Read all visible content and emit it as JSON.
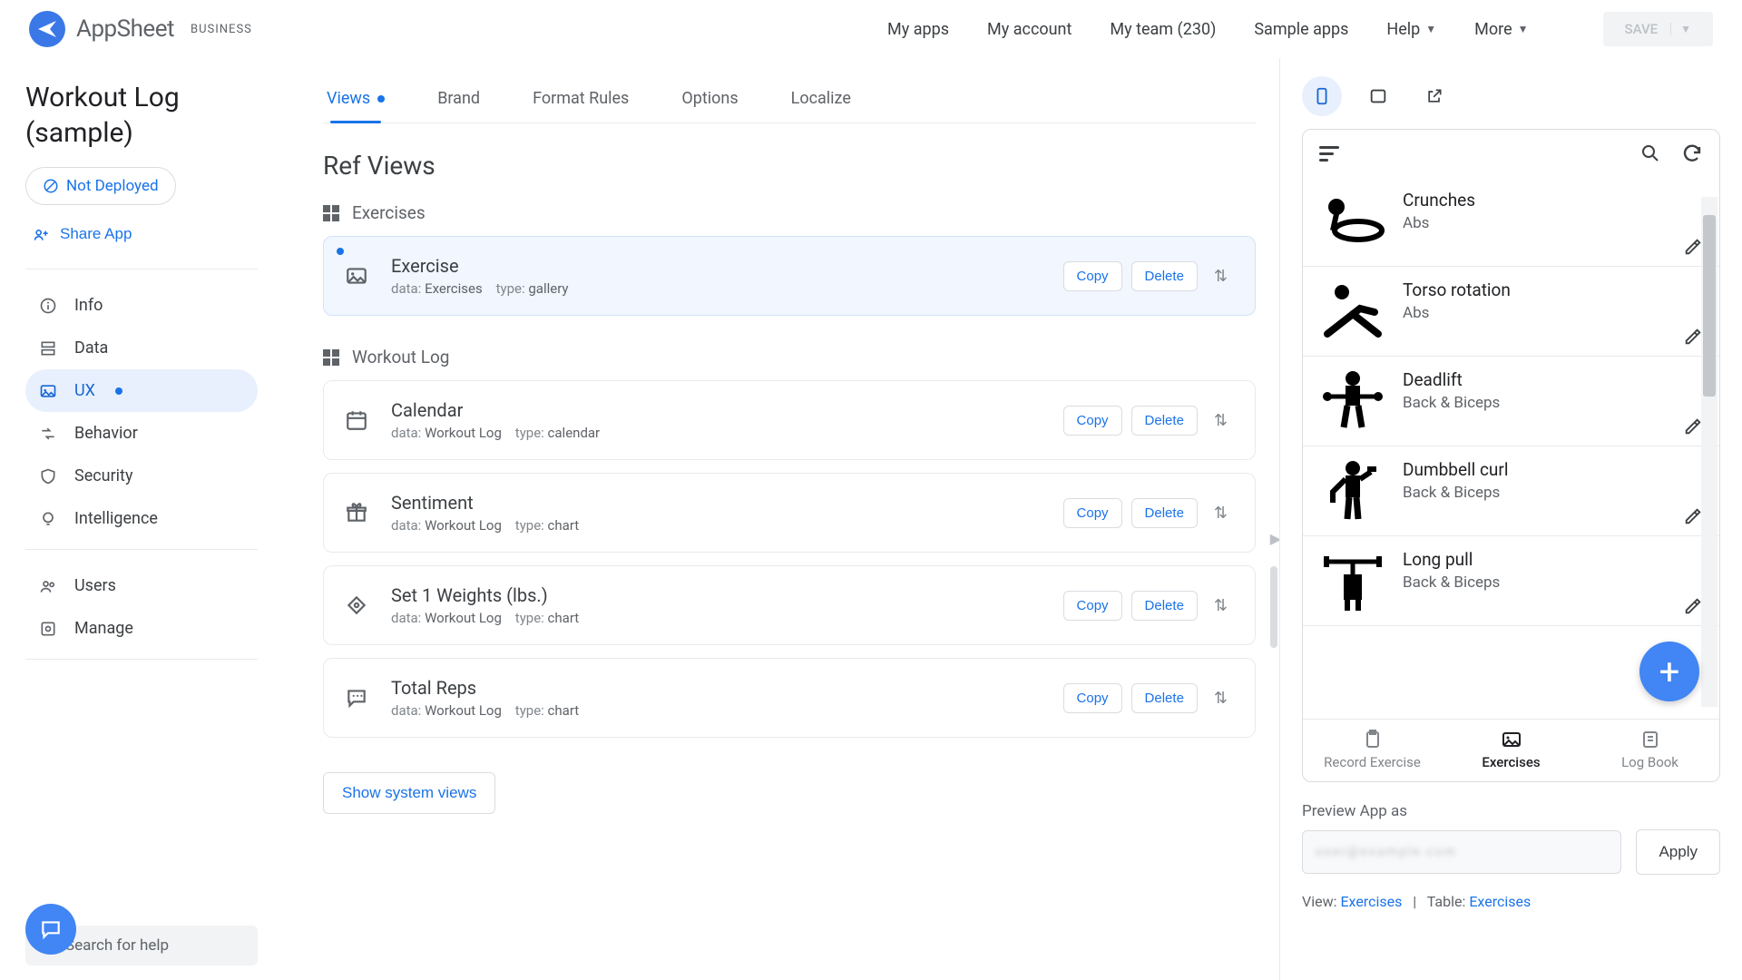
{
  "header": {
    "brand": "AppSheet",
    "tier": "BUSINESS",
    "nav": {
      "myapps": "My apps",
      "myaccount": "My account",
      "myteam": "My team (230)",
      "sample": "Sample apps",
      "help": "Help",
      "more": "More"
    },
    "save": "SAVE"
  },
  "sidebar": {
    "app_title": "Workout Log (sample)",
    "not_deployed": "Not Deployed",
    "share": "Share App",
    "items": {
      "info": "Info",
      "data": "Data",
      "ux": "UX",
      "behavior": "Behavior",
      "security": "Security",
      "intelligence": "Intelligence",
      "users": "Users",
      "manage": "Manage"
    },
    "search_placeholder": "Search for help"
  },
  "main": {
    "tabs": {
      "views": "Views",
      "brand": "Brand",
      "format": "Format Rules",
      "options": "Options",
      "localize": "Localize"
    },
    "heading": "Ref Views",
    "group1": "Exercises",
    "group2": "Workout Log",
    "labels": {
      "data": "data:",
      "type": "type:"
    },
    "actions": {
      "copy": "Copy",
      "delete": "Delete"
    },
    "cards": {
      "exercise": {
        "title": "Exercise",
        "data": "Exercises",
        "type": "gallery"
      },
      "calendar": {
        "title": "Calendar",
        "data": "Workout Log",
        "type": "calendar"
      },
      "sentiment": {
        "title": "Sentiment",
        "data": "Workout Log",
        "type": "chart"
      },
      "set1": {
        "title": "Set 1 Weights (lbs.)",
        "data": "Workout Log",
        "type": "chart"
      },
      "reps": {
        "title": "Total Reps",
        "data": "Workout Log",
        "type": "chart"
      }
    },
    "show_system": "Show system views"
  },
  "preview": {
    "rows": {
      "crunches": {
        "title": "Crunches",
        "sub": "Abs"
      },
      "torso": {
        "title": "Torso rotation",
        "sub": "Abs"
      },
      "deadlift": {
        "title": "Deadlift",
        "sub": "Back & Biceps"
      },
      "dumbbell": {
        "title": "Dumbbell curl",
        "sub": "Back & Biceps"
      },
      "longpull": {
        "title": "Long pull",
        "sub": "Back & Biceps"
      }
    },
    "tabs": {
      "record": "Record Exercise",
      "exercises": "Exercises",
      "logbook": "Log Book"
    },
    "preview_as": "Preview App as",
    "apply": "Apply",
    "footer": {
      "view_label": "View:",
      "view_val": "Exercises",
      "sep": "|",
      "table_label": "Table:",
      "table_val": "Exercises"
    }
  }
}
